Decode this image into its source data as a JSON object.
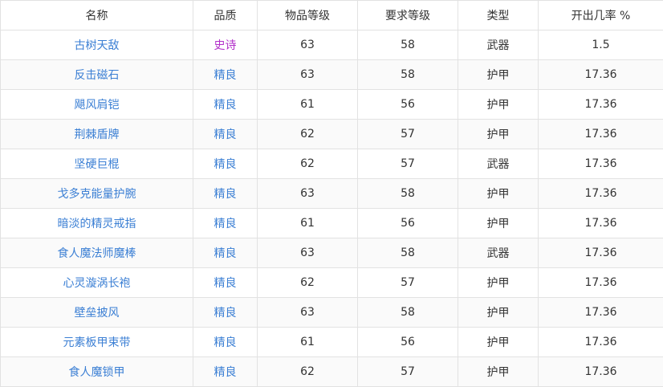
{
  "headers": {
    "name": "名称",
    "quality": "品质",
    "item_level": "物品等级",
    "required_level": "要求等级",
    "type": "类型",
    "drop_rate": "开出几率 %"
  },
  "colors": {
    "epic": "#b22fc9",
    "rare": "#3b7fd4"
  },
  "rows": [
    {
      "name": "古树天敌",
      "quality": "史诗",
      "quality_class": "epic",
      "item_level": "63",
      "required_level": "58",
      "type": "武器",
      "drop_rate": "1.5"
    },
    {
      "name": "反击磁石",
      "quality": "精良",
      "quality_class": "rare",
      "item_level": "63",
      "required_level": "58",
      "type": "护甲",
      "drop_rate": "17.36"
    },
    {
      "name": "飓风肩铠",
      "quality": "精良",
      "quality_class": "rare",
      "item_level": "61",
      "required_level": "56",
      "type": "护甲",
      "drop_rate": "17.36"
    },
    {
      "name": "荆棘盾牌",
      "quality": "精良",
      "quality_class": "rare",
      "item_level": "62",
      "required_level": "57",
      "type": "护甲",
      "drop_rate": "17.36"
    },
    {
      "name": "坚硬巨棍",
      "quality": "精良",
      "quality_class": "rare",
      "item_level": "62",
      "required_level": "57",
      "type": "武器",
      "drop_rate": "17.36"
    },
    {
      "name": "戈多克能量护腕",
      "quality": "精良",
      "quality_class": "rare",
      "item_level": "63",
      "required_level": "58",
      "type": "护甲",
      "drop_rate": "17.36"
    },
    {
      "name": "暗淡的精灵戒指",
      "quality": "精良",
      "quality_class": "rare",
      "item_level": "61",
      "required_level": "56",
      "type": "护甲",
      "drop_rate": "17.36"
    },
    {
      "name": "食人魔法师魔棒",
      "quality": "精良",
      "quality_class": "rare",
      "item_level": "63",
      "required_level": "58",
      "type": "武器",
      "drop_rate": "17.36"
    },
    {
      "name": "心灵漩涡长袍",
      "quality": "精良",
      "quality_class": "rare",
      "item_level": "62",
      "required_level": "57",
      "type": "护甲",
      "drop_rate": "17.36"
    },
    {
      "name": "壁垒披风",
      "quality": "精良",
      "quality_class": "rare",
      "item_level": "63",
      "required_level": "58",
      "type": "护甲",
      "drop_rate": "17.36"
    },
    {
      "name": "元素板甲束带",
      "quality": "精良",
      "quality_class": "rare",
      "item_level": "61",
      "required_level": "56",
      "type": "护甲",
      "drop_rate": "17.36"
    },
    {
      "name": "食人魔锁甲",
      "quality": "精良",
      "quality_class": "rare",
      "item_level": "62",
      "required_level": "57",
      "type": "护甲",
      "drop_rate": "17.36"
    }
  ]
}
